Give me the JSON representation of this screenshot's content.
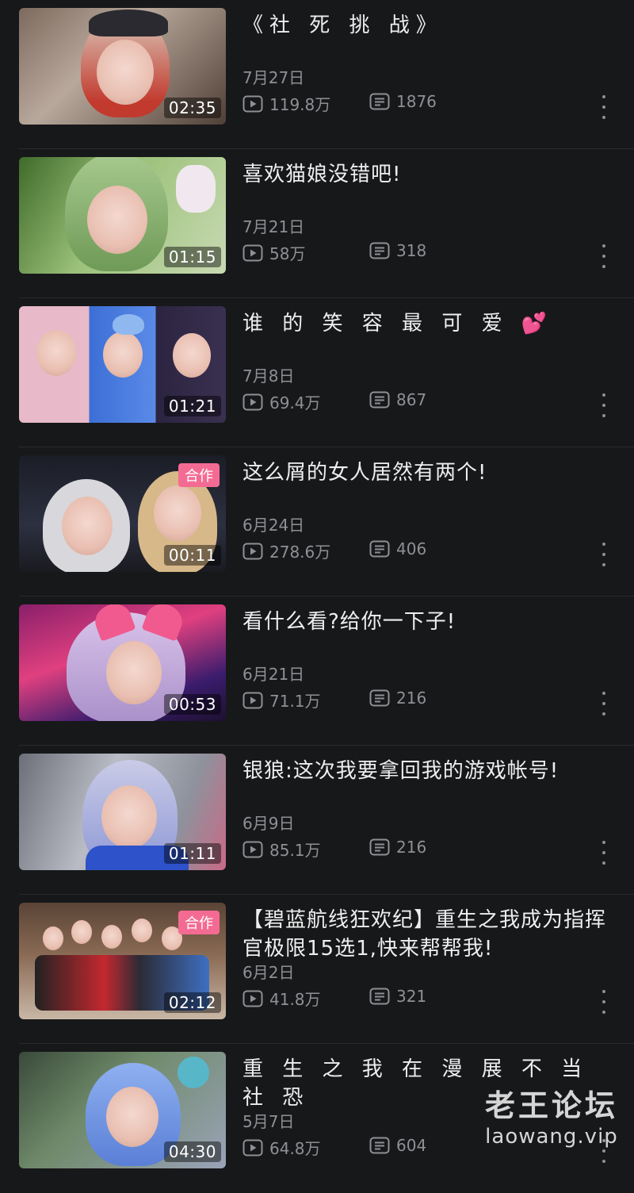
{
  "videos": [
    {
      "title": "《社 死 挑 战》",
      "date": "7月27日",
      "views": "119.8万",
      "comments": "1876",
      "duration": "02:35",
      "badge": ""
    },
    {
      "title": "喜欢猫娘没错吧!",
      "date": "7月21日",
      "views": "58万",
      "comments": "318",
      "duration": "01:15",
      "badge": ""
    },
    {
      "title": "谁 的 笑 容 最 可 爱 💕",
      "date": "7月8日",
      "views": "69.4万",
      "comments": "867",
      "duration": "01:21",
      "badge": ""
    },
    {
      "title": "这么屑的女人居然有两个!",
      "date": "6月24日",
      "views": "278.6万",
      "comments": "406",
      "duration": "00:11",
      "badge": "合作"
    },
    {
      "title": "看什么看?给你一下子!",
      "date": "6月21日",
      "views": "71.1万",
      "comments": "216",
      "duration": "00:53",
      "badge": ""
    },
    {
      "title": "银狼:这次我要拿回我的游戏帐号!",
      "date": "6月9日",
      "views": "85.1万",
      "comments": "216",
      "duration": "01:11",
      "badge": ""
    },
    {
      "title": "【碧蓝航线狂欢纪】重生之我成为指挥官极限15选1,快来帮帮我!",
      "date": "6月2日",
      "views": "41.8万",
      "comments": "321",
      "duration": "02:12",
      "badge": "合作"
    },
    {
      "title": "重 生 之 我 在 漫 展 不 当 社 恐",
      "date": "5月7日",
      "views": "64.8万",
      "comments": "604",
      "duration": "04:30",
      "badge": ""
    }
  ],
  "watermark": {
    "cn": "老王论坛",
    "url": "laowang.vip"
  },
  "icons": {
    "views": "play-icon",
    "comments": "danmaku-icon",
    "more": "more-vertical-icon"
  },
  "colors": {
    "background": "#17181a",
    "text": "#eeeeee",
    "meta": "#8f9094",
    "badge": "#f36b93"
  }
}
